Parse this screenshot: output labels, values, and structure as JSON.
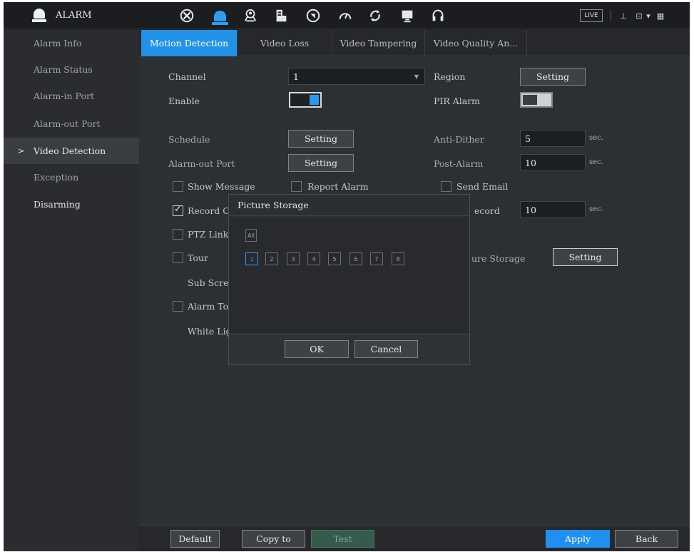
{
  "app": {
    "title": "ALARM",
    "live_label": "LIVE"
  },
  "topbar": {
    "icons": [
      "camera-icon",
      "alarm-icon",
      "search-person-icon",
      "storage-icon",
      "network-icon",
      "gauge-icon",
      "refresh-icon",
      "monitor-icon",
      "headset-icon"
    ],
    "active_icon": "alarm-icon"
  },
  "sidebar": {
    "items": [
      {
        "label": "Alarm Info"
      },
      {
        "label": "Alarm Status"
      },
      {
        "label": "Alarm-in Port"
      },
      {
        "label": "Alarm-out Port"
      },
      {
        "label": "Video Detection",
        "active": true
      },
      {
        "label": "Exception"
      },
      {
        "label": "Disarming"
      }
    ]
  },
  "tabs": [
    {
      "label": "Motion Detection",
      "active": true
    },
    {
      "label": "Video Loss"
    },
    {
      "label": "Video Tampering"
    },
    {
      "label": "Video Quality An..."
    }
  ],
  "form": {
    "channel_label": "Channel",
    "channel_value": "1",
    "region_label": "Region",
    "region_button": "Setting",
    "enable_label": "Enable",
    "enable_on": true,
    "pir_label": "PIR Alarm",
    "pir_on": false,
    "schedule_label": "Schedule",
    "schedule_button": "Setting",
    "antidither_label": "Anti-Dither",
    "antidither_value": "5",
    "antidither_unit": "sec.",
    "alarmout_label": "Alarm-out Port",
    "alarmout_button": "Setting",
    "postalarm_label": "Post-Alarm",
    "postalarm_value": "10",
    "postalarm_unit": "sec.",
    "show_message": "Show Message",
    "report_alarm": "Report Alarm",
    "send_email": "Send Email",
    "record_channel": "Record C",
    "record_visible": "ecord",
    "record_value": "10",
    "record_unit": "sec.",
    "ptz_link": "PTZ Link",
    "tour": "Tour",
    "picture_storage_visible": "ure Storage",
    "picture_storage_button": "Setting",
    "sub_screen": "Sub Scre",
    "alarm_tone": "Alarm To",
    "white_light": "White Lig"
  },
  "dialog": {
    "title": "Picture Storage",
    "all_label": "All",
    "channels": [
      "1",
      "2",
      "3",
      "4",
      "5",
      "6",
      "7",
      "8"
    ],
    "selected_channel": "1",
    "ok_label": "OK",
    "cancel_label": "Cancel"
  },
  "bottom": {
    "default_label": "Default",
    "copy_label": "Copy to",
    "test_label": "Test",
    "apply_label": "Apply",
    "back_label": "Back"
  },
  "colors": {
    "accent": "#2192e8",
    "test_green": "#345b4c"
  }
}
